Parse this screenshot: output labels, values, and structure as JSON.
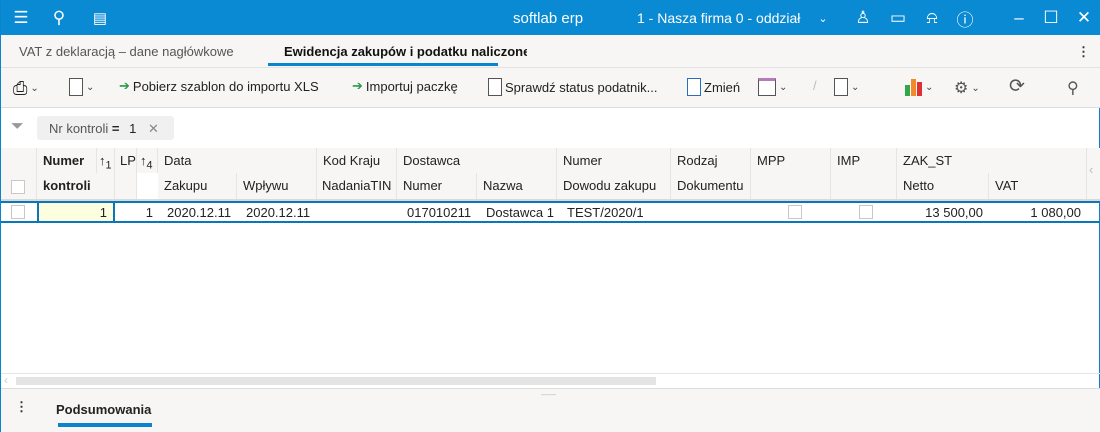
{
  "titlebar": {
    "app": "softlab erp",
    "company": "1 - Nasza firma 0 - oddział",
    "accent": "#0a8ad2"
  },
  "tabs": [
    {
      "label": "VAT z deklaracją – dane nagłówkowe"
    },
    {
      "label": "Ewidencja zakupów i podatku naliczonego"
    }
  ],
  "toolbar": {
    "download_template": "Pobierz szablon do importu XLS",
    "import_package": "Importuj paczkę",
    "check_status": "Sprawdź status podatnik...",
    "change": "Zmień"
  },
  "filter": {
    "field": "Nr kontroli",
    "operator": "=",
    "value": "1"
  },
  "columns": {
    "numer": "Numer",
    "kontroli": "kontroli",
    "sort1": "1",
    "lp": "LP",
    "sort4": "4",
    "data": "Data",
    "zakupu": "Zakupu",
    "wplywu": "Wpływu",
    "kod_kraju": "Kod Kraju",
    "nadania": "NadaniaTIN",
    "dostawca": "Dostawca",
    "dost_numer": "Numer",
    "nazwa": "Nazwa",
    "numer2": "Numer",
    "dowodu": "Dowodu zakupu",
    "rodzaj": "Rodzaj",
    "dokumentu": "Dokumentu",
    "mpp": "MPP",
    "imp": "IMP",
    "zak_st": "ZAK_ST",
    "netto": "Netto",
    "vat": "VAT"
  },
  "rows": [
    {
      "numer_kontroli": "1",
      "lp": "1",
      "data_zakupu": "2020.12.11",
      "data_wplywu": "2020.12.11",
      "kod_kraju": "",
      "dostawca_numer": "017010211",
      "dostawca_nazwa": "Dostawca 1",
      "dowod": "TEST/2020/1",
      "rodzaj": "",
      "mpp": false,
      "imp": false,
      "netto": "13 500,00",
      "vat": "1 080,00"
    }
  ],
  "bottom": {
    "tab": "Podsumowania"
  }
}
